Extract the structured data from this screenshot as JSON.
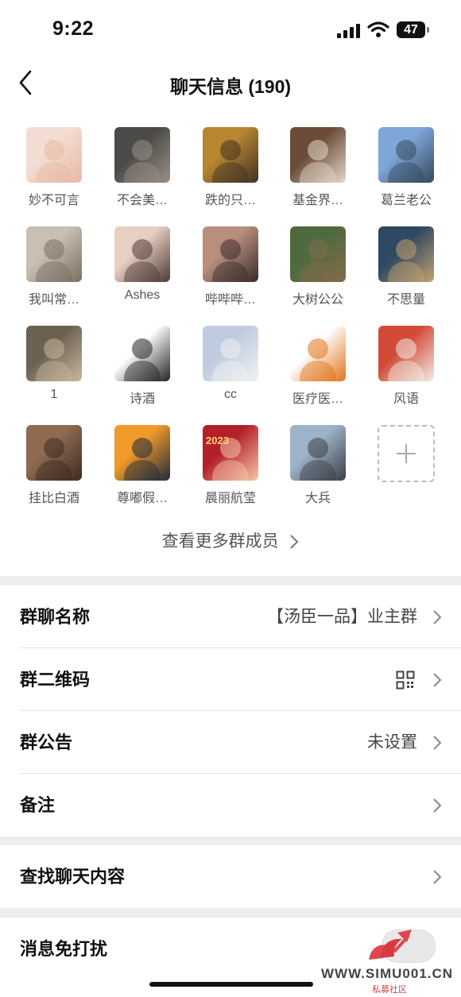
{
  "status_bar": {
    "time": "9:22",
    "battery": "47"
  },
  "nav": {
    "title": "聊天信息 (190)"
  },
  "members": [
    {
      "name": "妙不可言",
      "colors": [
        "#f3ddd2",
        "#e8b9a6"
      ]
    },
    {
      "name": "不会美…",
      "colors": [
        "#4b4a48",
        "#9a8f86"
      ]
    },
    {
      "name": "跌的只…",
      "colors": [
        "#b8862f",
        "#403224"
      ]
    },
    {
      "name": "基金界…",
      "colors": [
        "#6b4c3a",
        "#e6d8c8"
      ]
    },
    {
      "name": "葛兰老公",
      "colors": [
        "#7fa6d8",
        "#34495e"
      ]
    },
    {
      "name": "我叫常…",
      "colors": [
        "#c9bfb2",
        "#7b6f62"
      ]
    },
    {
      "name": "Ashes",
      "colors": [
        "#e7cfc2",
        "#4f3b35"
      ]
    },
    {
      "name": "哔哔哔…",
      "colors": [
        "#b98e7d",
        "#3a2c2a"
      ]
    },
    {
      "name": "大树公公",
      "colors": [
        "#4f6a3f",
        "#836b4b"
      ]
    },
    {
      "name": "不思量",
      "colors": [
        "#2f4863",
        "#c2a16e"
      ]
    },
    {
      "name": "1",
      "colors": [
        "#6b6151",
        "#c7b79c"
      ]
    },
    {
      "name": "诗酒",
      "colors": [
        "#ffffff",
        "#222222"
      ]
    },
    {
      "name": "cc",
      "colors": [
        "#bfcbe0",
        "#f1f1f1"
      ]
    },
    {
      "name": "医疗医…",
      "colors": [
        "#ffffff",
        "#e0741b"
      ]
    },
    {
      "name": "风语",
      "colors": [
        "#d24b37",
        "#f2ede7"
      ]
    },
    {
      "name": "挂比白酒",
      "colors": [
        "#8f6a51",
        "#3c2b22"
      ]
    },
    {
      "name": "尊嘟假…",
      "colors": [
        "#f09a2a",
        "#1f2a3a"
      ]
    },
    {
      "name": "晨丽航莹",
      "colors": [
        "#b3202a",
        "#f6c7a9"
      ],
      "badge": "2023"
    },
    {
      "name": "大兵",
      "colors": [
        "#9db3c8",
        "#3b3f44"
      ]
    }
  ],
  "more_link": "查看更多群成员",
  "settings": {
    "group_name": {
      "label": "群聊名称",
      "value": "【汤臣一品】业主群"
    },
    "qr_code": {
      "label": "群二维码"
    },
    "notice": {
      "label": "群公告",
      "value": "未设置"
    },
    "remark": {
      "label": "备注"
    },
    "search": {
      "label": "查找聊天内容"
    },
    "mute": {
      "label": "消息免打扰"
    }
  },
  "watermark": {
    "text": "WWW.SIMU001.CN",
    "sub": "私募社区"
  }
}
